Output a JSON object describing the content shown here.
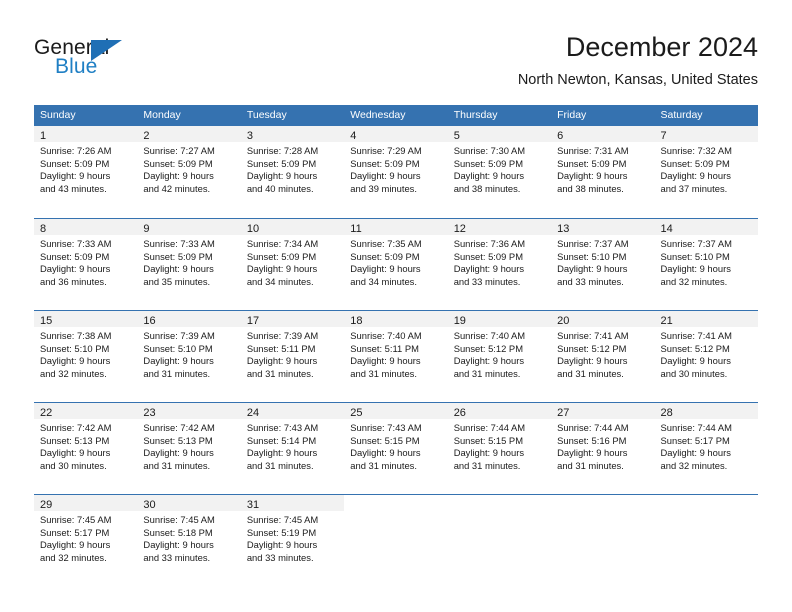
{
  "logo": {
    "word_general": "General",
    "word_blue": "Blue",
    "flag_color": "#1f6fb5",
    "blue_text_color": "#1f7fc4"
  },
  "header": {
    "title": "December 2024",
    "subtitle": "North Newton, Kansas, United States"
  },
  "theme": {
    "header_blue": "#3572b0",
    "daynum_strip_gray": "#f2f2f2",
    "text": "#1b1b1b"
  },
  "calendar": {
    "weekday_headers": [
      "Sunday",
      "Monday",
      "Tuesday",
      "Wednesday",
      "Thursday",
      "Friday",
      "Saturday"
    ],
    "weeks": [
      [
        {
          "day": "1",
          "sunrise": "Sunrise: 7:26 AM",
          "sunset": "Sunset: 5:09 PM",
          "daylight_line1": "Daylight: 9 hours",
          "daylight_line2": "and 43 minutes."
        },
        {
          "day": "2",
          "sunrise": "Sunrise: 7:27 AM",
          "sunset": "Sunset: 5:09 PM",
          "daylight_line1": "Daylight: 9 hours",
          "daylight_line2": "and 42 minutes."
        },
        {
          "day": "3",
          "sunrise": "Sunrise: 7:28 AM",
          "sunset": "Sunset: 5:09 PM",
          "daylight_line1": "Daylight: 9 hours",
          "daylight_line2": "and 40 minutes."
        },
        {
          "day": "4",
          "sunrise": "Sunrise: 7:29 AM",
          "sunset": "Sunset: 5:09 PM",
          "daylight_line1": "Daylight: 9 hours",
          "daylight_line2": "and 39 minutes."
        },
        {
          "day": "5",
          "sunrise": "Sunrise: 7:30 AM",
          "sunset": "Sunset: 5:09 PM",
          "daylight_line1": "Daylight: 9 hours",
          "daylight_line2": "and 38 minutes."
        },
        {
          "day": "6",
          "sunrise": "Sunrise: 7:31 AM",
          "sunset": "Sunset: 5:09 PM",
          "daylight_line1": "Daylight: 9 hours",
          "daylight_line2": "and 38 minutes."
        },
        {
          "day": "7",
          "sunrise": "Sunrise: 7:32 AM",
          "sunset": "Sunset: 5:09 PM",
          "daylight_line1": "Daylight: 9 hours",
          "daylight_line2": "and 37 minutes."
        }
      ],
      [
        {
          "day": "8",
          "sunrise": "Sunrise: 7:33 AM",
          "sunset": "Sunset: 5:09 PM",
          "daylight_line1": "Daylight: 9 hours",
          "daylight_line2": "and 36 minutes."
        },
        {
          "day": "9",
          "sunrise": "Sunrise: 7:33 AM",
          "sunset": "Sunset: 5:09 PM",
          "daylight_line1": "Daylight: 9 hours",
          "daylight_line2": "and 35 minutes."
        },
        {
          "day": "10",
          "sunrise": "Sunrise: 7:34 AM",
          "sunset": "Sunset: 5:09 PM",
          "daylight_line1": "Daylight: 9 hours",
          "daylight_line2": "and 34 minutes."
        },
        {
          "day": "11",
          "sunrise": "Sunrise: 7:35 AM",
          "sunset": "Sunset: 5:09 PM",
          "daylight_line1": "Daylight: 9 hours",
          "daylight_line2": "and 34 minutes."
        },
        {
          "day": "12",
          "sunrise": "Sunrise: 7:36 AM",
          "sunset": "Sunset: 5:09 PM",
          "daylight_line1": "Daylight: 9 hours",
          "daylight_line2": "and 33 minutes."
        },
        {
          "day": "13",
          "sunrise": "Sunrise: 7:37 AM",
          "sunset": "Sunset: 5:10 PM",
          "daylight_line1": "Daylight: 9 hours",
          "daylight_line2": "and 33 minutes."
        },
        {
          "day": "14",
          "sunrise": "Sunrise: 7:37 AM",
          "sunset": "Sunset: 5:10 PM",
          "daylight_line1": "Daylight: 9 hours",
          "daylight_line2": "and 32 minutes."
        }
      ],
      [
        {
          "day": "15",
          "sunrise": "Sunrise: 7:38 AM",
          "sunset": "Sunset: 5:10 PM",
          "daylight_line1": "Daylight: 9 hours",
          "daylight_line2": "and 32 minutes."
        },
        {
          "day": "16",
          "sunrise": "Sunrise: 7:39 AM",
          "sunset": "Sunset: 5:10 PM",
          "daylight_line1": "Daylight: 9 hours",
          "daylight_line2": "and 31 minutes."
        },
        {
          "day": "17",
          "sunrise": "Sunrise: 7:39 AM",
          "sunset": "Sunset: 5:11 PM",
          "daylight_line1": "Daylight: 9 hours",
          "daylight_line2": "and 31 minutes."
        },
        {
          "day": "18",
          "sunrise": "Sunrise: 7:40 AM",
          "sunset": "Sunset: 5:11 PM",
          "daylight_line1": "Daylight: 9 hours",
          "daylight_line2": "and 31 minutes."
        },
        {
          "day": "19",
          "sunrise": "Sunrise: 7:40 AM",
          "sunset": "Sunset: 5:12 PM",
          "daylight_line1": "Daylight: 9 hours",
          "daylight_line2": "and 31 minutes."
        },
        {
          "day": "20",
          "sunrise": "Sunrise: 7:41 AM",
          "sunset": "Sunset: 5:12 PM",
          "daylight_line1": "Daylight: 9 hours",
          "daylight_line2": "and 31 minutes."
        },
        {
          "day": "21",
          "sunrise": "Sunrise: 7:41 AM",
          "sunset": "Sunset: 5:12 PM",
          "daylight_line1": "Daylight: 9 hours",
          "daylight_line2": "and 30 minutes."
        }
      ],
      [
        {
          "day": "22",
          "sunrise": "Sunrise: 7:42 AM",
          "sunset": "Sunset: 5:13 PM",
          "daylight_line1": "Daylight: 9 hours",
          "daylight_line2": "and 30 minutes."
        },
        {
          "day": "23",
          "sunrise": "Sunrise: 7:42 AM",
          "sunset": "Sunset: 5:13 PM",
          "daylight_line1": "Daylight: 9 hours",
          "daylight_line2": "and 31 minutes."
        },
        {
          "day": "24",
          "sunrise": "Sunrise: 7:43 AM",
          "sunset": "Sunset: 5:14 PM",
          "daylight_line1": "Daylight: 9 hours",
          "daylight_line2": "and 31 minutes."
        },
        {
          "day": "25",
          "sunrise": "Sunrise: 7:43 AM",
          "sunset": "Sunset: 5:15 PM",
          "daylight_line1": "Daylight: 9 hours",
          "daylight_line2": "and 31 minutes."
        },
        {
          "day": "26",
          "sunrise": "Sunrise: 7:44 AM",
          "sunset": "Sunset: 5:15 PM",
          "daylight_line1": "Daylight: 9 hours",
          "daylight_line2": "and 31 minutes."
        },
        {
          "day": "27",
          "sunrise": "Sunrise: 7:44 AM",
          "sunset": "Sunset: 5:16 PM",
          "daylight_line1": "Daylight: 9 hours",
          "daylight_line2": "and 31 minutes."
        },
        {
          "day": "28",
          "sunrise": "Sunrise: 7:44 AM",
          "sunset": "Sunset: 5:17 PM",
          "daylight_line1": "Daylight: 9 hours",
          "daylight_line2": "and 32 minutes."
        }
      ],
      [
        {
          "day": "29",
          "sunrise": "Sunrise: 7:45 AM",
          "sunset": "Sunset: 5:17 PM",
          "daylight_line1": "Daylight: 9 hours",
          "daylight_line2": "and 32 minutes."
        },
        {
          "day": "30",
          "sunrise": "Sunrise: 7:45 AM",
          "sunset": "Sunset: 5:18 PM",
          "daylight_line1": "Daylight: 9 hours",
          "daylight_line2": "and 33 minutes."
        },
        {
          "day": "31",
          "sunrise": "Sunrise: 7:45 AM",
          "sunset": "Sunset: 5:19 PM",
          "daylight_line1": "Daylight: 9 hours",
          "daylight_line2": "and 33 minutes."
        },
        {
          "day": "",
          "sunrise": "",
          "sunset": "",
          "daylight_line1": "",
          "daylight_line2": ""
        },
        {
          "day": "",
          "sunrise": "",
          "sunset": "",
          "daylight_line1": "",
          "daylight_line2": ""
        },
        {
          "day": "",
          "sunrise": "",
          "sunset": "",
          "daylight_line1": "",
          "daylight_line2": ""
        },
        {
          "day": "",
          "sunrise": "",
          "sunset": "",
          "daylight_line1": "",
          "daylight_line2": ""
        }
      ]
    ]
  }
}
